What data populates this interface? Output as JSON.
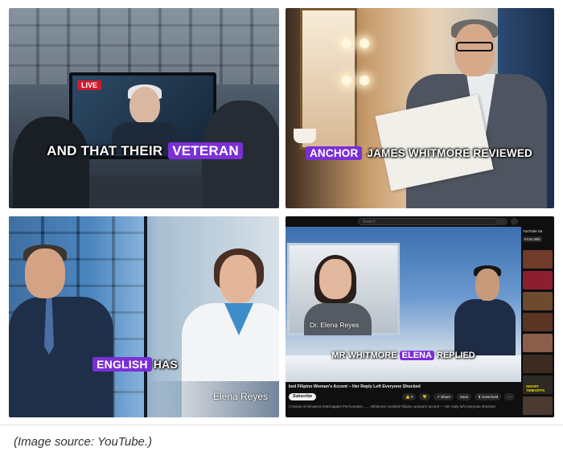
{
  "panels": {
    "p1": {
      "badge": "LIVE",
      "caption_plain": "AND THAT THEIR",
      "caption_highlight": "VETERAN"
    },
    "p2": {
      "caption_highlight": "ANCHOR",
      "caption_plain": "JAMES WHITMORE REVIEWED"
    },
    "p3": {
      "caption_highlight": "ENGLISH",
      "caption_plain": "HAS",
      "name_lower_third": "Elena Reyes"
    },
    "p4": {
      "search_placeholder": "Search",
      "inset_name": "Dr. Elena Reyes",
      "caption_plain": "MR WHITMORE",
      "caption_highlight": "ELENA",
      "caption_plain2": "REPLIED",
      "video_title": "ked Filipino Woman's Accent – Her Reply Left Everyone Shocked",
      "subscribe_label": "Subscribe",
      "actions": [
        "👍 0",
        "👎",
        "↗ Share",
        "Save",
        "⬇ Download",
        "⋯"
      ],
      "description": "l Hymps of elevatrns interrogates Pet+lovetion... ... Whitmore mocked Filipino woman's accent — her reply left everyone shocked",
      "sidebar_title": "YouTube Sa",
      "sidebar_chip": "From Whi",
      "thumbnails": [
        {
          "text": "",
          "color": "#6f3b2a"
        },
        {
          "text": "",
          "color": "#8c1f2f"
        },
        {
          "text": "",
          "color": "#6e4a2f"
        },
        {
          "text": "",
          "color": "#5a3524"
        },
        {
          "text": "",
          "color": "#8a5e4a"
        },
        {
          "text": "",
          "color": "#3c2b20"
        },
        {
          "text": "SMART TIMEOFFS",
          "color": "#2d2a26"
        },
        {
          "text": "",
          "color": "#4a3a30"
        }
      ]
    }
  },
  "footer": {
    "source_caption": "(Image source: YouTube.)"
  }
}
